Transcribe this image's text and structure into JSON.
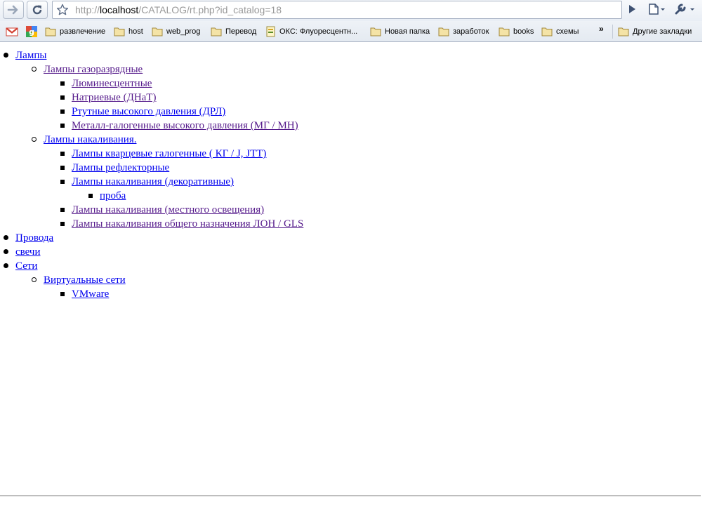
{
  "browser": {
    "url_prefix": "http://",
    "url_host": "localhost",
    "url_path": "/CATALOG/rt.php?id_catalog=18"
  },
  "bookmarks": {
    "items": [
      {
        "label": "развлечение"
      },
      {
        "label": "host"
      },
      {
        "label": "web_prog"
      },
      {
        "label": "Перевод"
      },
      {
        "label": "ОКС: Флуоресцентн..."
      },
      {
        "label": "Новая папка"
      },
      {
        "label": "заработок"
      },
      {
        "label": "books"
      },
      {
        "label": "схемы"
      }
    ],
    "overflow": "»",
    "other": "Другие закладки"
  },
  "catalog": {
    "lamps": "Лампы",
    "gas_discharge": "Лампы газоразрядные",
    "fluorescent": "Люминесцентные",
    "sodium": "Натриевые (ДНаТ)",
    "mercury": "Ртутные высокого давления (ДРЛ)",
    "metal_halide": "Металл-галогенные высокого давления (МГ / MH)",
    "incandescent": "Лампы накаливания.",
    "quartz_halogen": "Лампы кварцевые галогенные ( КГ / J, JTT)",
    "reflector": "Лампы рефлекторные",
    "decorative": "Лампы накаливания (декоративные)",
    "test": "проба",
    "local_light": "Лампы накаливания (местного освещения)",
    "general": "Лампы накаливания общего назначения ЛОН / GLS",
    "wires": "Провода",
    "candles": "свечи",
    "networks": "Сети",
    "virtual_networks": "Виртуальные сети",
    "vmware": "VMware"
  }
}
